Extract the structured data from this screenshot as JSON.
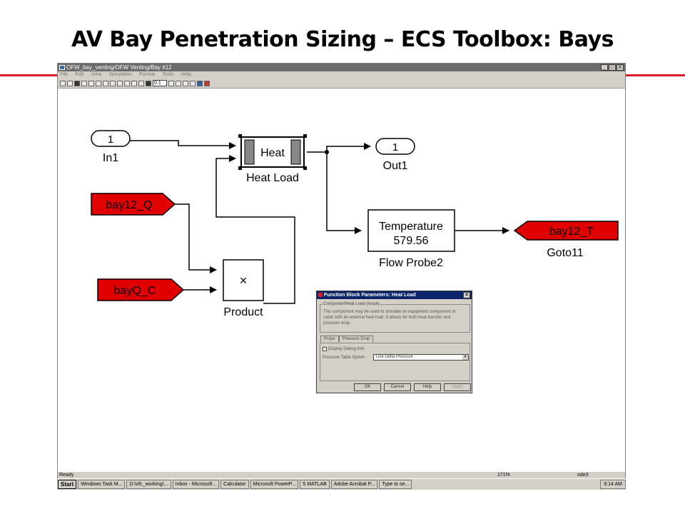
{
  "slide": {
    "title": "AV Bay Penetration Sizing – ECS Toolbox: Bays",
    "accent_color": "#d4202a"
  },
  "window": {
    "title": "OFW_bay_venting/OFW Venting/Bay #12",
    "controls": [
      "_",
      "□",
      "X"
    ],
    "menu": [
      "File",
      "Edit",
      "View",
      "Simulation",
      "Format",
      "Tools",
      "Help"
    ],
    "toolbar": {
      "sim_time": "0.1"
    }
  },
  "diagram": {
    "in_port": {
      "number": "1",
      "label": "In1"
    },
    "out_port": {
      "number": "1",
      "label": "Out1"
    },
    "heat_block": {
      "text": "Heat",
      "label": "Heat Load"
    },
    "from_bay12_q": {
      "text": "bay12_Q"
    },
    "from_bayq_c": {
      "text": "bayQ_C"
    },
    "product_block": {
      "symbol": "×",
      "label": "Product"
    },
    "temp_probe": {
      "line1": "Temperature",
      "value": "579.56",
      "label": "Flow Probe2"
    },
    "goto_block": {
      "text": "bay12_T",
      "label": "Goto11"
    }
  },
  "dialog": {
    "title": "Function Block Parameters: Heat Load",
    "group_title": "ComponentHeat Load (mask)",
    "description": "This component may be used to simulate an equipment component or cabin with an external heat load. It allows for both heat transfer and pressure drop.",
    "tabs": [
      "Props",
      "Pressure Drop"
    ],
    "checkbox_label": "Display Debug Info",
    "select_label": "Pressure Table Option",
    "select_value": "Use Delta Pressure",
    "buttons": {
      "ok": "OK",
      "cancel": "Cancel",
      "help": "Help",
      "apply": "Apply"
    }
  },
  "status": {
    "left": "Ready",
    "zoom": "171%",
    "mode": "ode3"
  },
  "taskbar": {
    "start": "Start",
    "items": [
      "Windows Task M...",
      "D:\\ofc_working\\...",
      "Inbox - Microsoft...",
      "Calculator",
      "Microsoft PowerP...",
      "5 MATLAB",
      "Adobe Acrobat P..."
    ],
    "search": "Type to se...",
    "clock": "9:14 AM"
  }
}
